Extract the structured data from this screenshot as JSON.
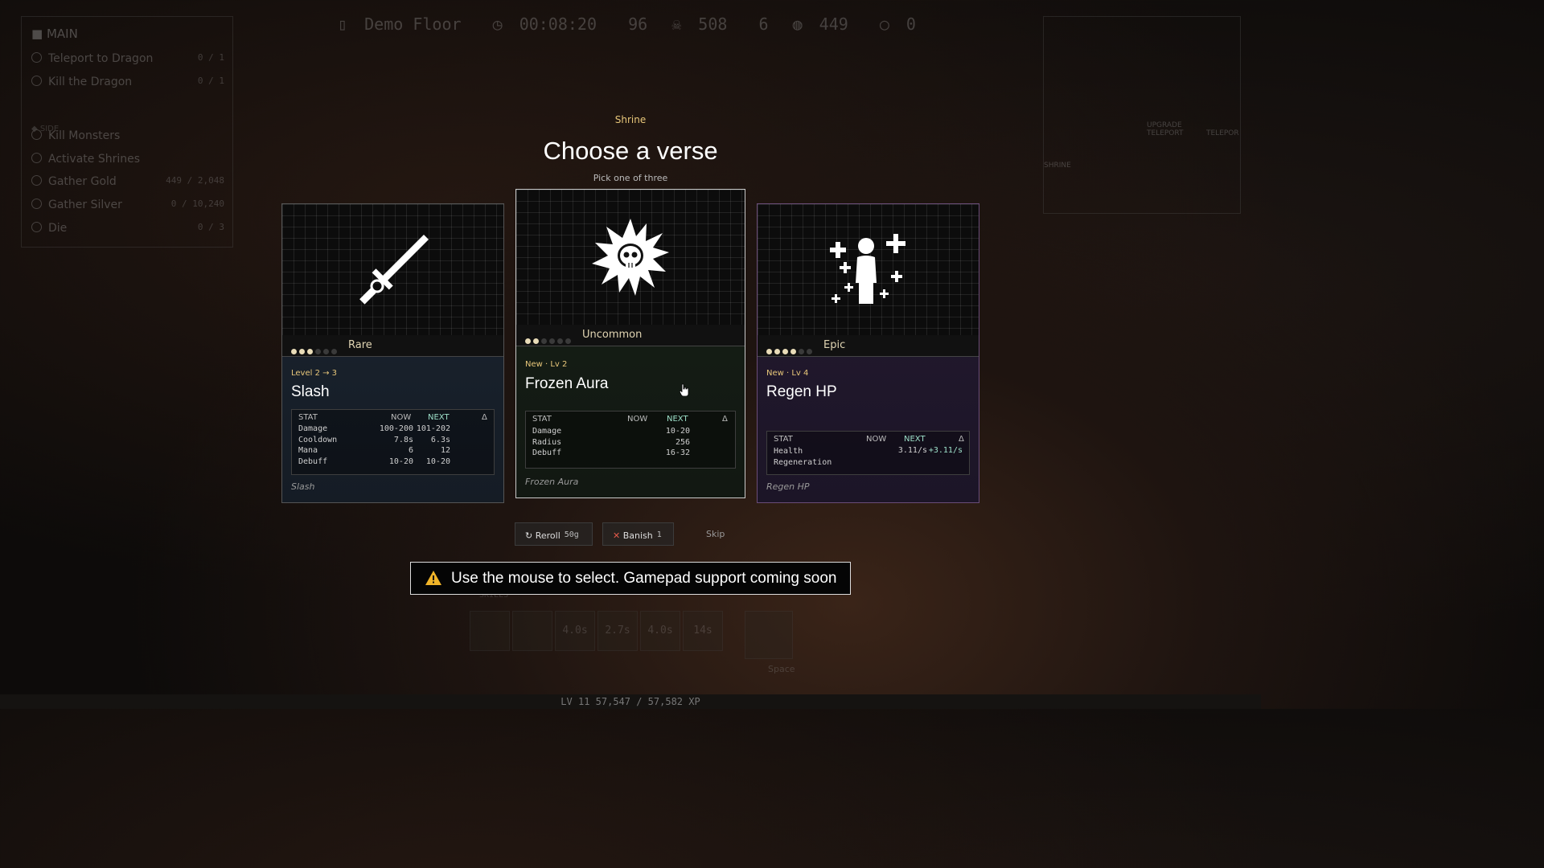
{
  "quests": {
    "main_title": "MAIN",
    "side_title": "SIDE",
    "main": [
      {
        "label": "Teleport to Dragon",
        "count": "0 / 1"
      },
      {
        "label": "Kill the Dragon",
        "count": "0 / 1"
      }
    ],
    "side": [
      {
        "label": "Kill Monsters",
        "count": ""
      },
      {
        "label": "Activate Shrines",
        "count": ""
      },
      {
        "label": "Gather Gold",
        "count": "449 / 2,048"
      },
      {
        "label": "Gather Silver",
        "count": "0 / 10,240"
      },
      {
        "label": "Die",
        "count": "0 / 3"
      }
    ]
  },
  "topbar": {
    "floor": "Demo Floor",
    "timer": "00:08:20",
    "kills": "96",
    "skulls": "508",
    "stat3": "6",
    "gold": "449",
    "silver": "0"
  },
  "minimap": {
    "upgrade_label": "UPGRADE TELEPORT",
    "teleport_label": "TELEPOR",
    "shrine_label": "SHRINE"
  },
  "dialog": {
    "kicker": "Shrine",
    "title": "Choose a verse",
    "subtitle": "Pick one of three"
  },
  "cards": [
    {
      "rarity": "Rare",
      "pips_on": 3,
      "pips_total": 6,
      "level": "Level 2 → 3",
      "name": "Slash",
      "stat_header": [
        "STAT",
        "NOW",
        "NEXT",
        "Δ"
      ],
      "stats": [
        {
          "stat": "Damage",
          "now": "100-200",
          "next": "101-202"
        },
        {
          "stat": "Cooldown",
          "now": "7.8s",
          "next": "6.3s"
        },
        {
          "stat": "Mana",
          "now": "6",
          "next": "12"
        },
        {
          "stat": "Debuff",
          "now": "10-20",
          "next": "10-20"
        }
      ],
      "flavor": "Slash",
      "icon": "sword-icon"
    },
    {
      "rarity": "Uncommon",
      "pips_on": 2,
      "pips_total": 6,
      "level": "New · Lv 2",
      "name": "Frozen Aura",
      "stat_header": [
        "STAT",
        "NOW",
        "NEXT",
        "Δ"
      ],
      "stats": [
        {
          "stat": "Damage",
          "now": "",
          "next": "10-20"
        },
        {
          "stat": "Radius",
          "now": "",
          "next": "256"
        },
        {
          "stat": "Debuff",
          "now": "",
          "next": "16-32"
        }
      ],
      "flavor": "Frozen Aura",
      "icon": "skull-burst-icon"
    },
    {
      "rarity": "Epic",
      "pips_on": 4,
      "pips_total": 6,
      "level": "New · Lv 4",
      "name": "Regen HP",
      "stat_header": [
        "STAT",
        "NOW",
        "NEXT",
        "Δ"
      ],
      "stats": [
        {
          "stat": "Health Regeneration",
          "now": "",
          "next": "3.11/s",
          "delta": "+3.11/s"
        }
      ],
      "flavor": "Regen HP",
      "icon": "healing-person-icon"
    }
  ],
  "actions": {
    "reroll": "Reroll",
    "reroll_cost": "50g",
    "banish": "Banish",
    "banish_count": "1",
    "skip": "Skip"
  },
  "toast": "Use the mouse to select. Gamepad support coming soon",
  "skills": {
    "label": "SKILLS",
    "cooldowns": [
      "",
      "",
      "4.0s",
      "2.7s",
      "4.0s",
      "14s"
    ],
    "dash_key": "Space"
  },
  "xp_bar": "LV 11  57,547 / 57,582 XP"
}
